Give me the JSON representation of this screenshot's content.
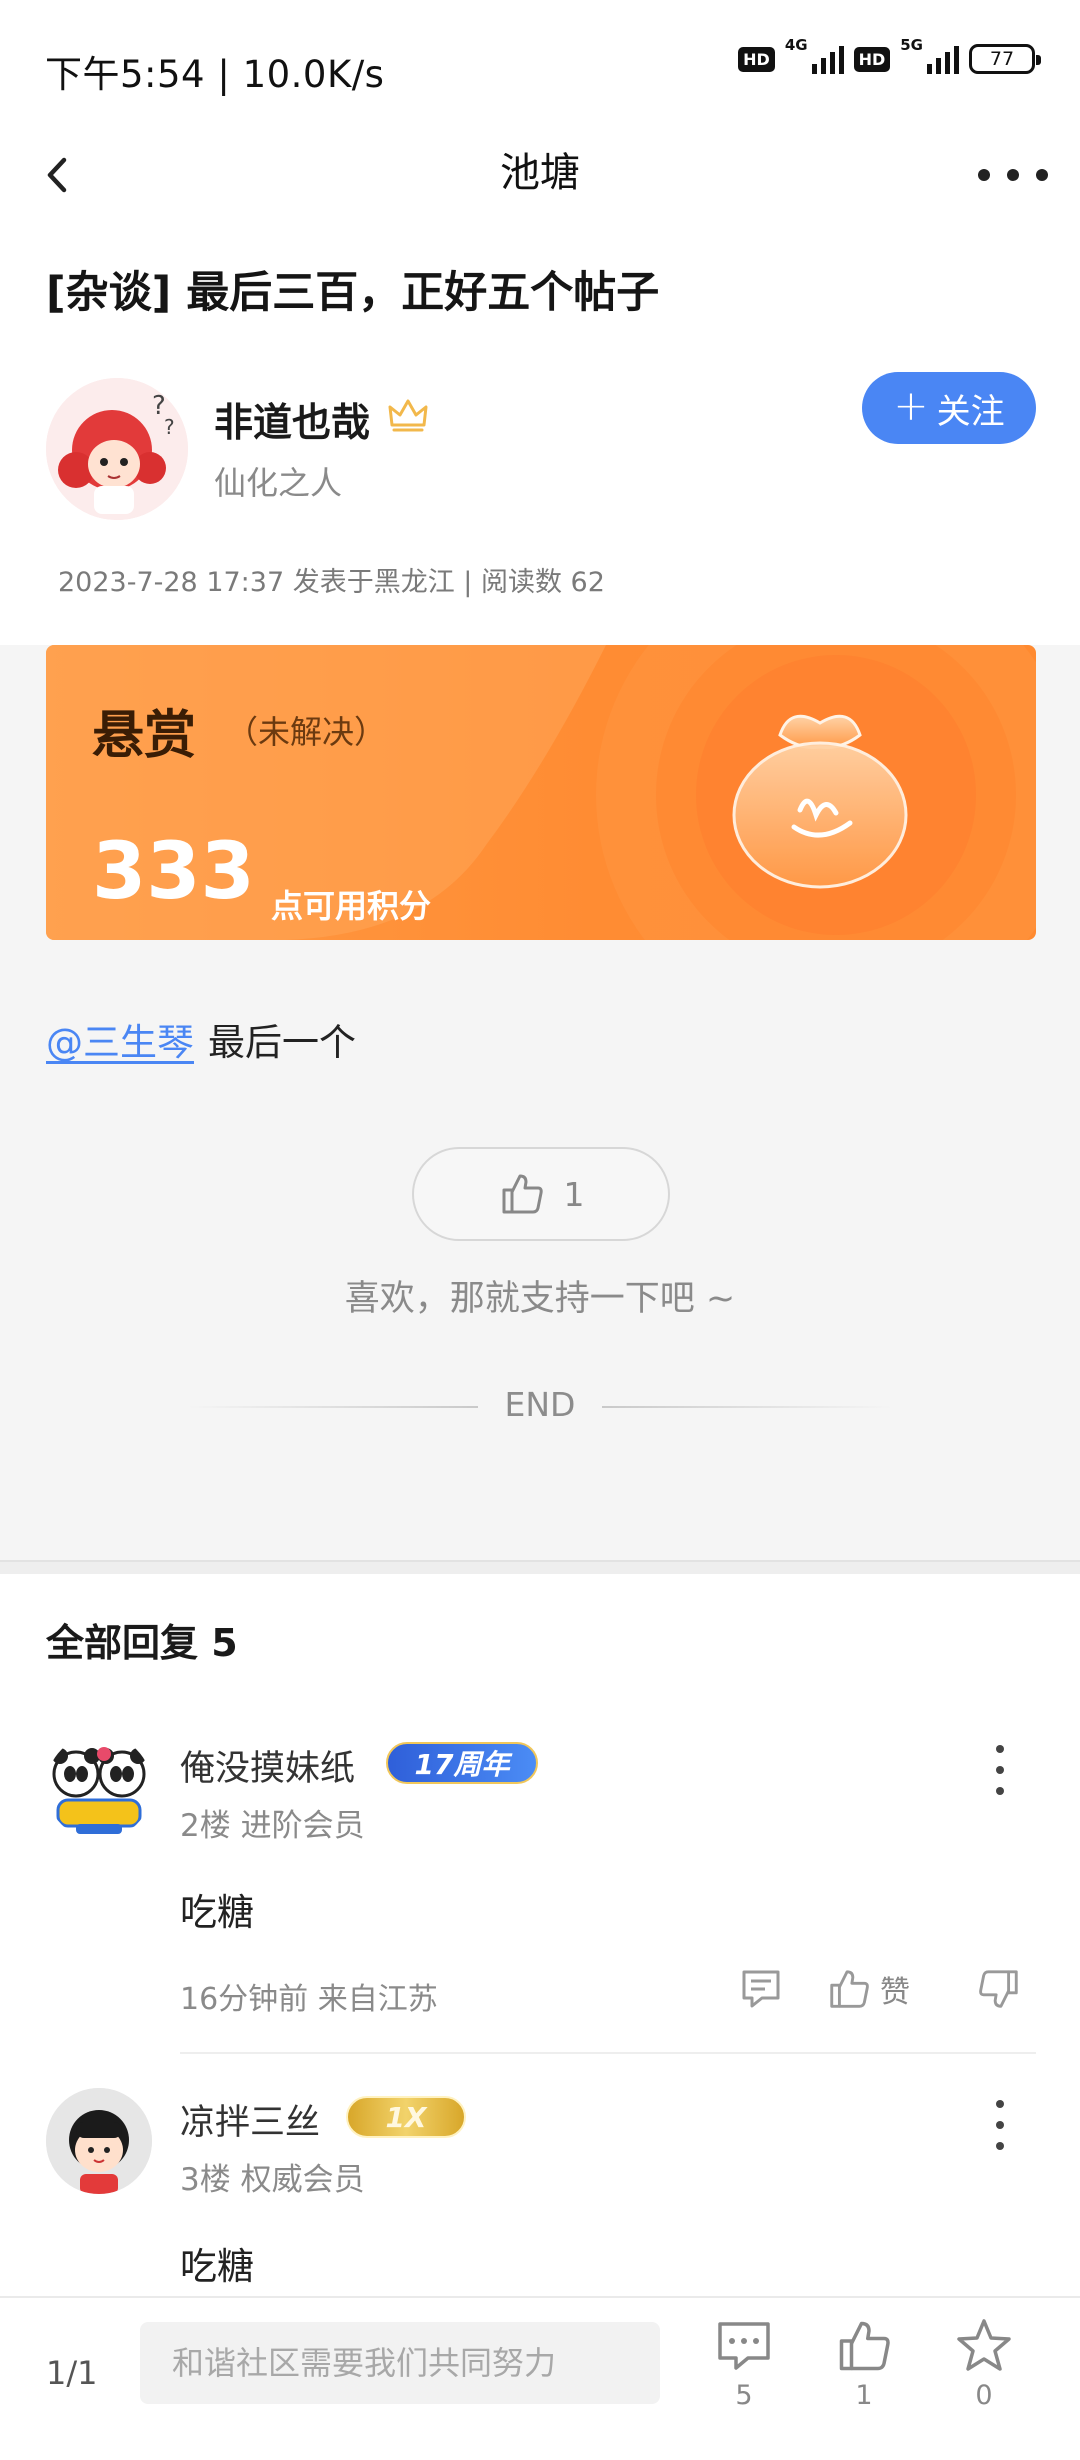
{
  "status_bar": {
    "time": "下午5:54 | 10.0K/s",
    "hd_label": "HD",
    "net1": "4G",
    "net2": "5G",
    "battery": "77"
  },
  "title_bar": {
    "title": "池塘"
  },
  "post": {
    "title": "[杂谈] 最后三百，正好五个帖子",
    "author": {
      "name": "非道也哉",
      "title": "仙化之人"
    },
    "follow_label": "关注",
    "meta": "2023-7-28 17:37 发表于黑龙江 | 阅读数 62",
    "bounty": {
      "title": "悬赏",
      "status": "（未解决）",
      "amount": "333",
      "unit": "点可用积分"
    },
    "mention": "@三生琴",
    "content": "最后一个",
    "likes": "1",
    "support_text": "喜欢，那就支持一下吧 ~",
    "end_label": "END"
  },
  "replies": {
    "header": "全部回复  5",
    "items": [
      {
        "name": "俺没摸妹纸",
        "badge": "17周年",
        "meta": "2楼  进阶会员",
        "content": "吃糖",
        "time": "16分钟前  来自江苏",
        "like_label": "赞"
      },
      {
        "name": "凉拌三丝",
        "badge": "1X",
        "meta": "3楼  权威会员",
        "content": "吃糖"
      }
    ]
  },
  "bottom_bar": {
    "page": "1/1",
    "input_placeholder": "和谐社区需要我们共同努力",
    "comments_count": "5",
    "likes_count": "1",
    "favorites_count": "0"
  },
  "colors": {
    "accent_blue": "#4a86f4",
    "bounty_orange": "#ff8c33"
  }
}
